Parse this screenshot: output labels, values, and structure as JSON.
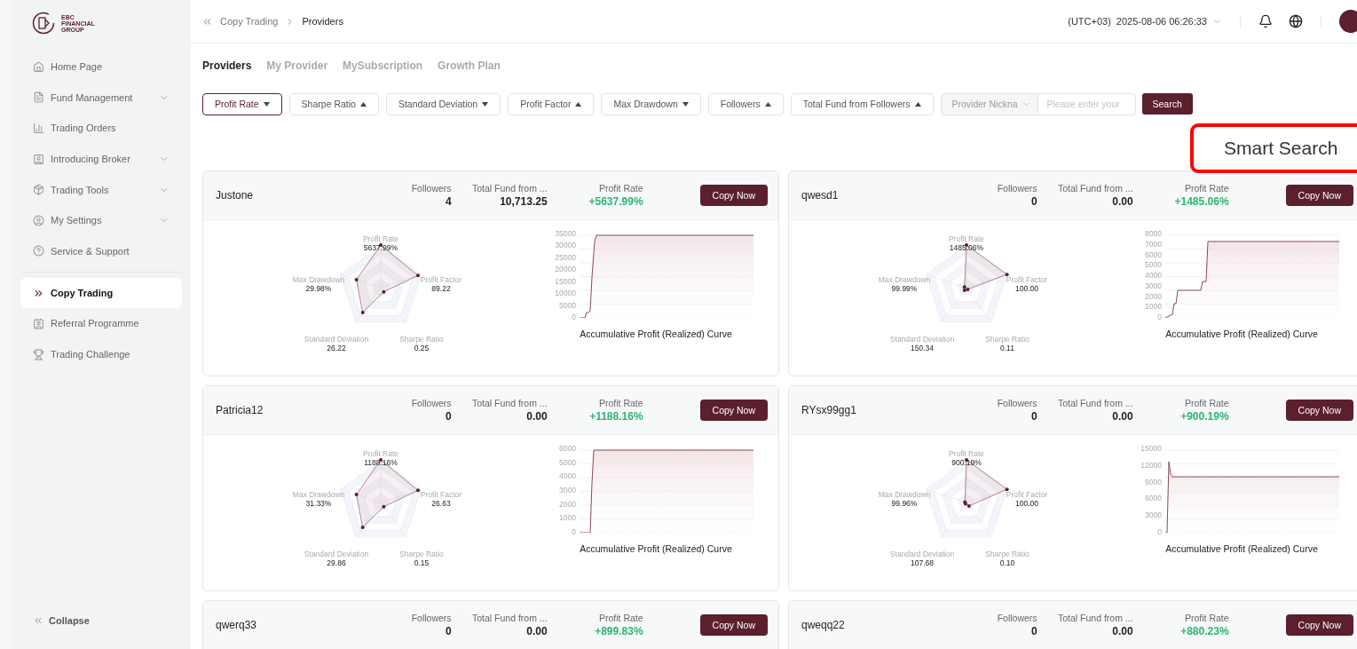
{
  "sidebar": {
    "logo_text": [
      "EBC",
      "FINANCIAL",
      "GROUP"
    ],
    "items": [
      {
        "label": "Home Page",
        "expandable": false,
        "selected": false
      },
      {
        "label": "Fund Management",
        "expandable": true,
        "selected": false
      },
      {
        "label": "Trading Orders",
        "expandable": false,
        "selected": false
      },
      {
        "label": "Introducing Broker",
        "expandable": true,
        "selected": false
      },
      {
        "label": "Trading Tools",
        "expandable": true,
        "selected": false
      },
      {
        "label": "My Settings",
        "expandable": true,
        "selected": false
      },
      {
        "label": "Service & Support",
        "expandable": false,
        "selected": false
      },
      {
        "label": "Copy Trading",
        "expandable": false,
        "selected": true
      },
      {
        "label": "Referral Programme",
        "expandable": false,
        "selected": false
      },
      {
        "label": "Trading Challenge",
        "expandable": false,
        "selected": false
      }
    ],
    "collapse": "Collapse"
  },
  "header": {
    "breadcrumb": [
      "Copy Trading",
      "Providers"
    ],
    "timezone": "(UTC+03)",
    "datetime": "2025-08-06 06:26:33"
  },
  "tabs": [
    {
      "label": "Providers",
      "selected": true
    },
    {
      "label": "My Provider",
      "selected": false
    },
    {
      "label": "MySubscription",
      "selected": false
    },
    {
      "label": "Growth Plan",
      "selected": false
    }
  ],
  "sort_buttons": [
    {
      "label": "Profit Rate",
      "ascending": false,
      "selected": true
    },
    {
      "label": "Sharpe Ratio",
      "ascending": true,
      "selected": false
    },
    {
      "label": "Standard Deviation",
      "ascending": false,
      "selected": false
    },
    {
      "label": "Profit Factor",
      "ascending": true,
      "selected": false
    },
    {
      "label": "Max Drawdown",
      "ascending": false,
      "selected": false
    },
    {
      "label": "Followers",
      "ascending": true,
      "selected": false
    },
    {
      "label": "Total Fund from Followers",
      "ascending": true,
      "selected": false
    }
  ],
  "search": {
    "field": "Provider Nickna",
    "placeholder": "Please enter your",
    "button": "Search"
  },
  "smart_search_note": "Smart Search",
  "providers": [
    {
      "name": "Justone",
      "followers_label": "Followers",
      "followers": "4",
      "fund_label": "Total Fund from ...",
      "fund": "10,713.25",
      "rate_label": "Profit Rate",
      "rate": "+5637.99%",
      "button": "Copy Now",
      "metrics": [
        {
          "label": "Profit Rate",
          "value": "5637.99%"
        },
        {
          "label": "Max Drawdown",
          "value": "29.98%"
        },
        {
          "label": "Profit Factor",
          "value": "89.22"
        },
        {
          "label": "Standard Deviation",
          "value": "26.22"
        },
        {
          "label": "Sharpe Ratio",
          "value": "0.25"
        }
      ],
      "yticks": [
        "35000",
        "30000",
        "25000",
        "20000",
        "15000",
        "10000",
        "5000",
        "0"
      ],
      "curve_title": "Accumulative Profit (Realized)  Curve"
    },
    {
      "name": "qwesd1",
      "followers_label": "Followers",
      "followers": "0",
      "fund_label": "Total Fund from ...",
      "fund": "0.00",
      "rate_label": "Profit Rate",
      "rate": "+1485.06%",
      "button": "Copy Now",
      "metrics": [
        {
          "label": "Profit Rate",
          "value": "1485.06%"
        },
        {
          "label": "Max Drawdown",
          "value": "99.99%"
        },
        {
          "label": "Profit Factor",
          "value": "100.00"
        },
        {
          "label": "Standard Deviation",
          "value": "150.34"
        },
        {
          "label": "Sharpe Ratio",
          "value": "0.11"
        }
      ],
      "yticks": [
        "8000",
        "7000",
        "6000",
        "5000",
        "4000",
        "3000",
        "2000",
        "1000",
        "0"
      ],
      "curve_title": "Accumulative Profit (Realized)  Curve"
    },
    {
      "name": "Patricia12",
      "followers_label": "Followers",
      "followers": "0",
      "fund_label": "Total Fund from ...",
      "fund": "0.00",
      "rate_label": "Profit Rate",
      "rate": "+1188.16%",
      "button": "Copy Now",
      "metrics": [
        {
          "label": "Profit Rate",
          "value": "1188.16%"
        },
        {
          "label": "Max Drawdown",
          "value": "31.33%"
        },
        {
          "label": "Profit Factor",
          "value": "26.63"
        },
        {
          "label": "Standard Deviation",
          "value": "29.86"
        },
        {
          "label": "Sharpe Ratio",
          "value": "0.15"
        }
      ],
      "yticks": [
        "6000",
        "5000",
        "4000",
        "3000",
        "2000",
        "1000",
        "0"
      ],
      "curve_title": "Accumulative Profit (Realized)  Curve"
    },
    {
      "name": "RYsx99gg1",
      "followers_label": "Followers",
      "followers": "0",
      "fund_label": "Total Fund from ...",
      "fund": "0.00",
      "rate_label": "Profit Rate",
      "rate": "+900.19%",
      "button": "Copy Now",
      "metrics": [
        {
          "label": "Profit Rate",
          "value": "900.19%"
        },
        {
          "label": "Max Drawdown",
          "value": "99.96%"
        },
        {
          "label": "Profit Factor",
          "value": "100.00"
        },
        {
          "label": "Standard Deviation",
          "value": "107.68"
        },
        {
          "label": "Sharpe Ratio",
          "value": "0.10"
        }
      ],
      "yticks": [
        "15000",
        "12000",
        "9000",
        "6000",
        "3000",
        "0"
      ],
      "curve_title": "Accumulative Profit (Realized)  Curve"
    },
    {
      "name": "qwerq33",
      "followers_label": "Followers",
      "followers": "0",
      "fund_label": "Total Fund from ...",
      "fund": "0.00",
      "rate_label": "Profit Rate",
      "rate": "+899.83%",
      "button": "Copy Now"
    },
    {
      "name": "qweqq22",
      "followers_label": "Followers",
      "followers": "0",
      "fund_label": "Total Fund from ...",
      "fund": "0.00",
      "rate_label": "Profit Rate",
      "rate": "+880.23%",
      "button": "Copy Now"
    }
  ]
}
